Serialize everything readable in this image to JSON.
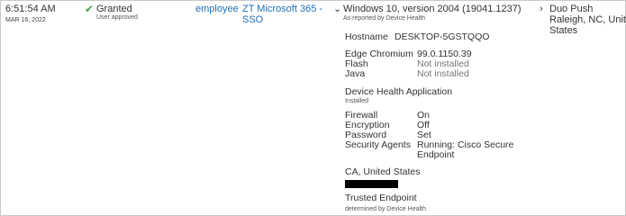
{
  "row": {
    "time": "6:51:54 AM",
    "date": "MAR 16, 2022",
    "result": {
      "label": "Granted",
      "detail": "User approved",
      "icon": "check-icon"
    },
    "user": "employee",
    "application": {
      "line1": "ZT Microsoft 365 -",
      "line2": "SSO"
    },
    "device": {
      "os": "Windows 10, version 2004 (19041.1237)",
      "os_source": "As reported by Device Health",
      "hostname_label": "Hostname",
      "hostname_value": "DESKTOP-5GSTQQO",
      "software": [
        {
          "label": "Edge Chromium",
          "value": "99.0.1150.39"
        },
        {
          "label": "Flash",
          "value": "Not installed"
        },
        {
          "label": "Java",
          "value": "Not installed"
        }
      ],
      "dha_title": "Device Health Application",
      "dha_status": "Installed",
      "security": [
        {
          "label": "Firewall",
          "value": "On"
        },
        {
          "label": "Encryption",
          "value": "Off"
        },
        {
          "label": "Password",
          "value": "Set"
        },
        {
          "label": "Security Agents",
          "value": "Running: Cisco Secure",
          "value2": "Endpoint"
        }
      ],
      "location": "CA, United States",
      "trusted_title": "Trusted Endpoint",
      "trusted_source": "determined by Device Health"
    },
    "factor": {
      "method": "Duo Push",
      "city": "Raleigh, NC, United",
      "country": "States"
    }
  }
}
